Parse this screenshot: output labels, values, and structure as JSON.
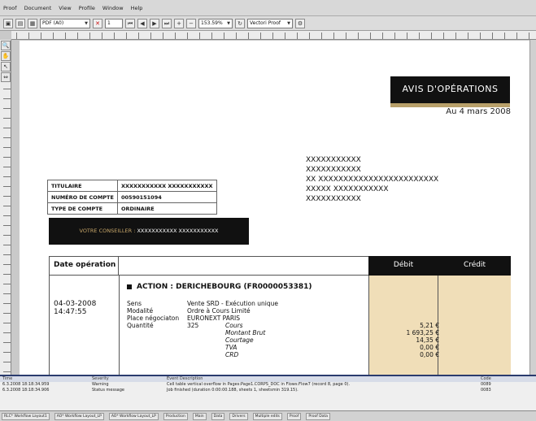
{
  "menu": [
    "Proof",
    "Document",
    "View",
    "Profile",
    "Window",
    "Help"
  ],
  "toolbar": {
    "format": "PDF (A0)",
    "page": "1",
    "zoom": "153.59%",
    "profile": "Vectori Proof"
  },
  "document": {
    "title": "AVIS D'OPÉRATIONS",
    "date": "Au 4 mars 2008",
    "address": [
      "XXXXXXXXXXX",
      "XXXXXXXXXXX",
      "XX XXXXXXXXXXXXXXXXXXXXXXXX",
      "XXXXX XXXXXXXXXXX",
      "XXXXXXXXXXX"
    ],
    "account": [
      {
        "label": "TITULAIRE",
        "value": "XXXXXXXXXXX XXXXXXXXXXX"
      },
      {
        "label": "NUMÉRO DE COMPTE",
        "value": "00590151094"
      },
      {
        "label": "TYPE DE COMPTE",
        "value": "ORDINAIRE"
      }
    ],
    "advisor_label": "VOTRE CONSEILLER :",
    "advisor_name": "XXXXXXXXXXX XXXXXXXXXXX",
    "table": {
      "col_date": "Date opération",
      "col_debit": "Débit",
      "col_credit": "Crédit"
    },
    "operation": {
      "date": "04-03-2008",
      "time": "14:47:55",
      "title": "ACTION : DERICHEBOURG (FR0000053381)",
      "details": [
        {
          "label": "Sens",
          "value": "Vente SRD - Exécution unique"
        },
        {
          "label": "Modalité",
          "value": "Ordre à Cours Limité"
        },
        {
          "label": "Place négociaton",
          "value": "EURONEXT PARIS"
        },
        {
          "label": "Quantité",
          "value": "325",
          "sub": "Cours",
          "amount": "5,21 €"
        }
      ],
      "lines": [
        {
          "label": "Montant Brut",
          "amount": "1 693,25 €"
        },
        {
          "label": "Courtage",
          "amount": "14,35 €"
        },
        {
          "label": "TVA",
          "amount": "0,00 €"
        },
        {
          "label": "CRD",
          "amount": "0,00 €"
        }
      ]
    }
  },
  "log": {
    "headers": [
      "Time",
      "Severity",
      "Event Description",
      "Code"
    ],
    "rows": [
      {
        "time": "6.3.2008 18:18:34.959",
        "severity": "Warning",
        "desc": "Cell table vertical overflow in Pages:Page1.CORPS_DOC in Flows:Flow7 (record 8, page 0).",
        "code": "0089"
      },
      {
        "time": "6.3.2008 18:18:34.906",
        "severity": "Status message",
        "desc": "Job finished (duration 0:00:00.188, sheets 1, sheetsmin 319.15).",
        "code": "0083"
      }
    ]
  },
  "statusbar": [
    "RLC* Workflow Layout1",
    "AO* Workflow Layout_LP",
    "AO* Workflow Layout_LP",
    "Production",
    "Main",
    "Data",
    "Drivers",
    "Multiple edits",
    "Proof",
    "Proof Data"
  ]
}
